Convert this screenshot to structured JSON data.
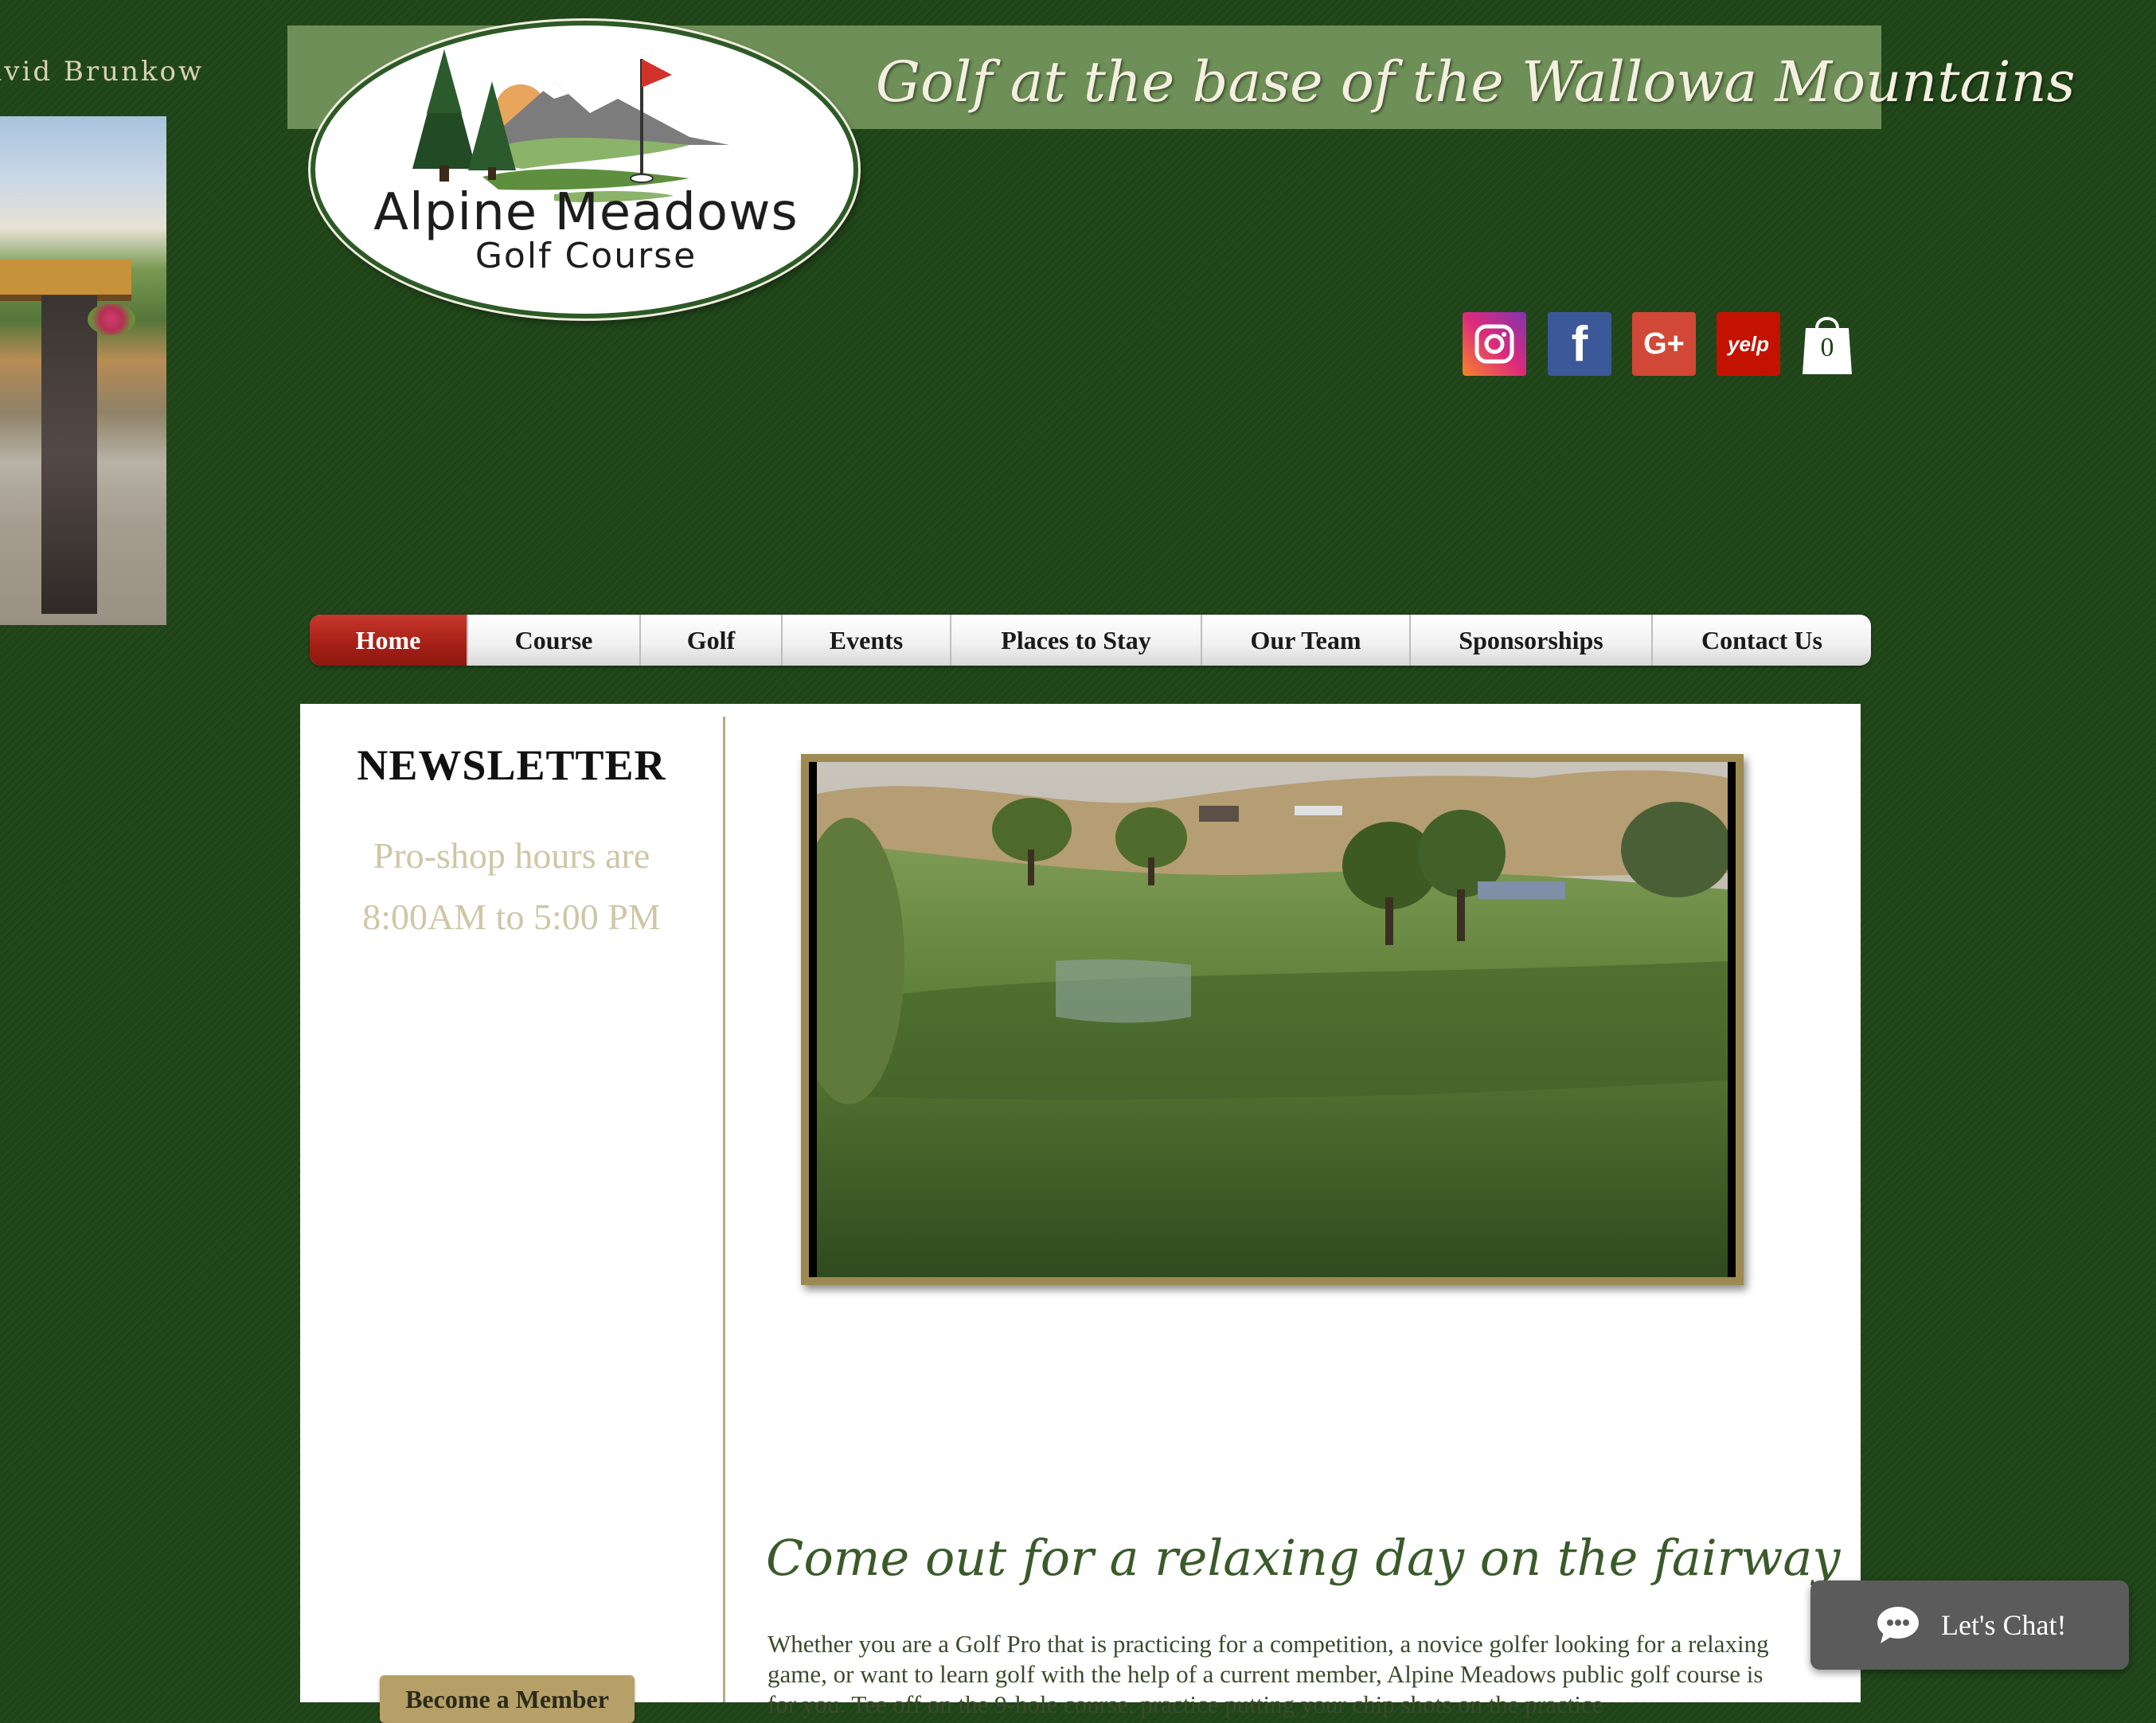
{
  "credit": "avid Brunkow",
  "logo": {
    "line1": "Alpine Meadows",
    "line2": "Golf Course"
  },
  "header": {
    "tagline": "Golf at the base of the Wallowa Mountains"
  },
  "social": {
    "icons": [
      "instagram-icon",
      "facebook-icon",
      "google-plus-icon",
      "yelp-icon",
      "shopping-bag-icon"
    ],
    "google_label": "G+",
    "yelp_label": "yelp",
    "facebook_label": "f",
    "cart_count": "0"
  },
  "nav": {
    "items": [
      {
        "label": "Home",
        "active": true
      },
      {
        "label": "Course"
      },
      {
        "label": "Golf"
      },
      {
        "label": "Events"
      },
      {
        "label": "Places to Stay"
      },
      {
        "label": "Our Team"
      },
      {
        "label": "Sponsorships"
      },
      {
        "label": "Contact Us"
      }
    ]
  },
  "sidebar": {
    "title": "NEWSLETTER",
    "hours_line1": "Pro-shop hours are",
    "hours_line2": "8:00AM to 5:00 PM",
    "member_button": "Become a Member"
  },
  "main": {
    "headline": "Come out for a relaxing day on the fairway",
    "body": "Whether you are a Golf Pro that is practicing for a competition, a novice golfer looking for a relaxing game, or want to learn golf with the help of a current member, Alpine Meadows public golf course is for you. Tee off on the 9-hole course, practice putting your chip shots on the practice"
  },
  "chat": {
    "label": "Let's Chat!"
  },
  "colors": {
    "background": "#1f4418",
    "banner": "#6e8f57",
    "nav_active": "#a41f16",
    "headline": "#3a5a2a",
    "hours_text": "#cfc6a6",
    "video_frame": "#9c8a52"
  }
}
